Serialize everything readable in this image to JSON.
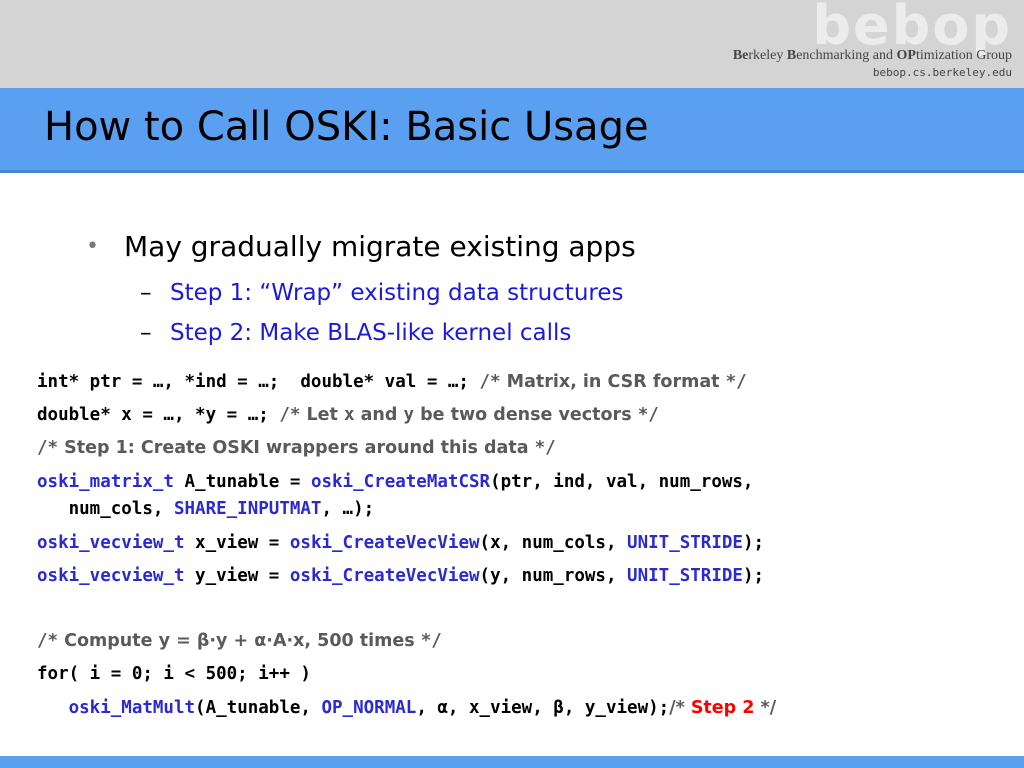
{
  "header": {
    "logo": "bebop",
    "group_b1": "Be",
    "group_t1": "rkeley ",
    "group_b2": "B",
    "group_t2": "enchmarking and ",
    "group_b3": "OP",
    "group_t3": "timization Group",
    "url": "bebop.cs.berkeley.edu"
  },
  "slide": {
    "title": "How to Call OSKI: Basic Usage",
    "bullet_glyph": "•",
    "dash_glyph": "–",
    "bullet": "May gradually migrate existing apps",
    "sub1": "Step 1: “Wrap” existing data structures",
    "sub2": "Step 2: Make BLAS-like kernel calls"
  },
  "code": {
    "l1a": "int* ptr = …, *ind = …;  double* val = …; ",
    "l1c1": "/*",
    "l1c2": " Matrix, in CSR format ",
    "l1c3": "*/",
    "l2a": "double* x = …, *y = …; ",
    "l2c1": "/*",
    "l2c2": " Let ",
    "l2x": "x",
    "l2c3": " and ",
    "l2y": "y",
    "l2c4": " be two dense vectors ",
    "l2c5": "*/",
    "l3c1": "/*",
    "l3c2": " Step 1: Create OSKI wrappers around this data ",
    "l3c3": "*/",
    "l4k1": "oski_matrix_t",
    "l4a": " A_tunable = ",
    "l4k2": "oski_CreateMatCSR",
    "l4b": "(ptr, ind, val, num_rows,",
    "l5a": "   num_cols, ",
    "l5k": "SHARE_INPUTMAT",
    "l5b": ", …);",
    "l6k1": "oski_vecview_t",
    "l6a": " x_view = ",
    "l6k2": "oski_CreateVecView",
    "l6b": "(x, num_cols, ",
    "l6k3": "UNIT_STRIDE",
    "l6c": ");",
    "l7k1": "oski_vecview_t",
    "l7a": " y_view = ",
    "l7k2": "oski_CreateVecView",
    "l7b": "(y, num_rows, ",
    "l7k3": "UNIT_STRIDE",
    "l7c": ");",
    "l8c1": "/*",
    "l8c2": " Compute y = β·y + α·A·x, 500 times ",
    "l8c3": "*/",
    "l9": "for( i = 0; i < 500; i++ )",
    "l10pad": "   ",
    "l10k1": "oski_MatMult",
    "l10a": "(A_tunable, ",
    "l10k2": "OP_NORMAL",
    "l10b": ", α, x_view, β, y_view);",
    "l10c1": "/* ",
    "l10red": "Step 2",
    "l10c2": " */"
  }
}
